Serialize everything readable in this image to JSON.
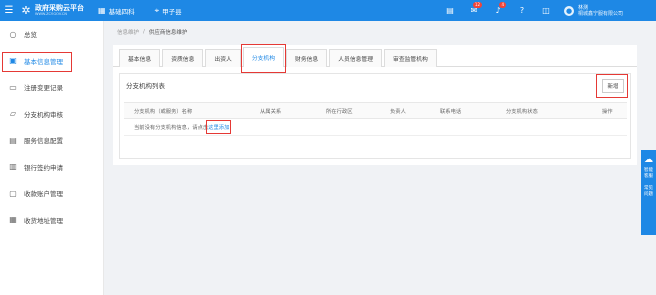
{
  "header": {
    "logo_title": "政府采购云平台",
    "logo_subtitle": "WWW.ZCY.GOV.CN",
    "nav": [
      {
        "icon": "grid-icon",
        "label": "基础四科"
      },
      {
        "icon": "location-icon",
        "label": "甲子县"
      }
    ],
    "mail_badge": "12",
    "bell_badge": "4",
    "user_name": "林测",
    "company": "桐城鑫宁服有限公司"
  },
  "sidebar": {
    "items": [
      {
        "label": "总览",
        "icon": "circle-icon"
      },
      {
        "label": "基本信息管理",
        "icon": "id-card-icon"
      },
      {
        "label": "注册变更记录",
        "icon": "record-icon"
      },
      {
        "label": "分支机构审核",
        "icon": "branch-audit-icon"
      },
      {
        "label": "服务信息配置",
        "icon": "service-config-icon"
      },
      {
        "label": "银行签约申请",
        "icon": "bank-icon"
      },
      {
        "label": "收款账户管理",
        "icon": "account-icon"
      },
      {
        "label": "收货地址管理",
        "icon": "address-icon"
      }
    ]
  },
  "breadcrumb": {
    "home": "信息维护",
    "sep": "/",
    "current": "供应商信息维护"
  },
  "tabs": [
    "基本信息",
    "资质信息",
    "出资人",
    "分支机构",
    "财务信息",
    "人员信息管理",
    "审查监管机构"
  ],
  "section": {
    "title": "分支机构列表",
    "new_button": "新增",
    "columns": [
      "分支机构（或服务）名称",
      "从属关系",
      "所在行政区",
      "负责人",
      "联系电话",
      "分支机构状态",
      "操作"
    ],
    "empty_text": "当前没有分支机构信息，请点击",
    "empty_link": "这里添加"
  },
  "float_panel": {
    "items": [
      {
        "icon": "chat-icon",
        "label": "智能客服"
      },
      {
        "icon": "question-icon",
        "label": "常见问题"
      }
    ]
  }
}
